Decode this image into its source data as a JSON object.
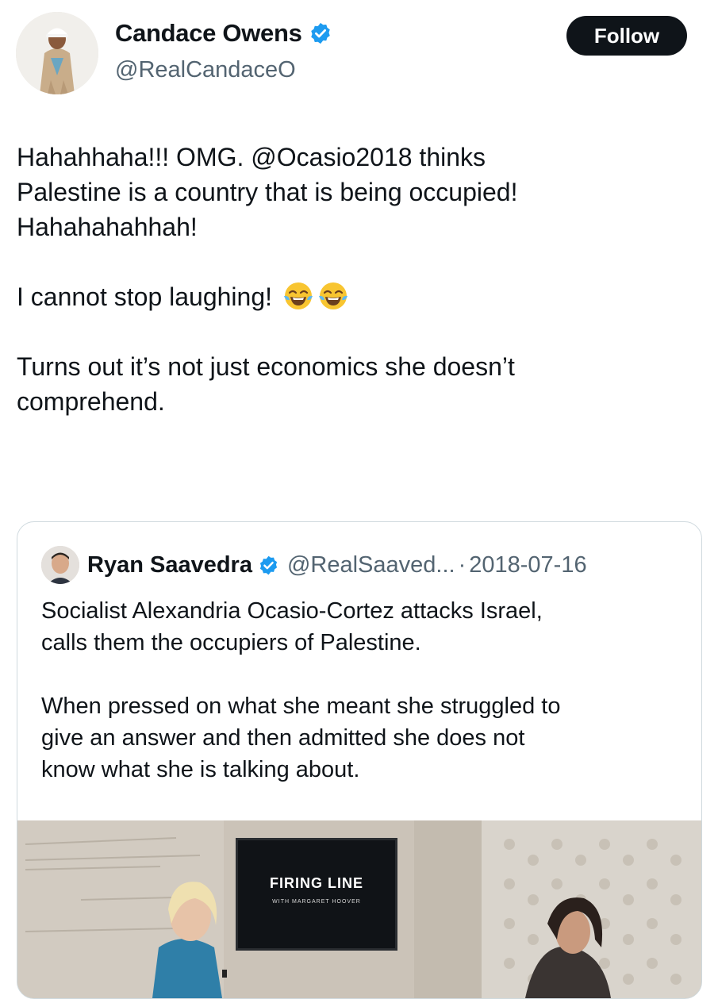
{
  "header": {
    "display_name": "Candace Owens",
    "handle": "@RealCandaceO",
    "follow_label": "Follow"
  },
  "tweet": {
    "line1": "Hahahhaha!!! OMG. @Ocasio2018 thinks",
    "line2": "Palestine is a country that is being occupied!",
    "line3": "Hahahahahhah!",
    "line4": "I cannot stop laughing!",
    "line5": "Turns out it’s not just economics she doesn’t",
    "line6": "comprehend.",
    "emojis": [
      "face-with-tears-of-joy",
      "face-with-tears-of-joy"
    ]
  },
  "quote": {
    "display_name": "Ryan Saavedra",
    "handle": "@RealSaaved...",
    "separator": "·",
    "date": "2018-07-16",
    "line1": "Socialist Alexandria Ocasio-Cortez attacks Israel,",
    "line2": "calls them the occupiers of Palestine.",
    "line3": "When pressed on what she meant she struggled to",
    "line4": "give an answer and then admitted she does not",
    "line5": "know what she is talking about.",
    "media": {
      "show_title": "FIRING LINE",
      "show_subtitle": "WITH MARGARET HOOVER"
    }
  },
  "colors": {
    "text_primary": "#0f1419",
    "text_secondary": "#536471",
    "verified_blue": "#1d9bf0",
    "border": "#cfd9de",
    "follow_bg": "#0f1419"
  }
}
